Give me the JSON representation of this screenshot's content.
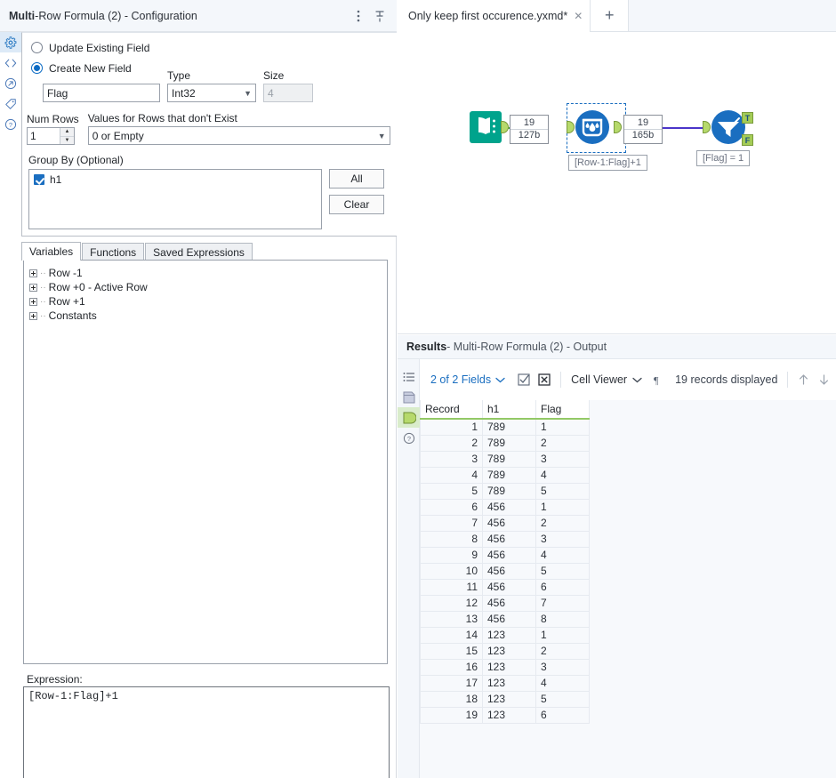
{
  "config_panel": {
    "title_bold": "Multi",
    "title_rest": "-Row Formula (2) - Configuration",
    "menu_icon": "kebab-menu-icon",
    "pin_icon": "pin-icon",
    "rail": [
      {
        "name": "gear-icon",
        "glyph": "⚙"
      },
      {
        "name": "code-icon",
        "glyph": "<>"
      },
      {
        "name": "runtime-icon",
        "glyph": "↗"
      },
      {
        "name": "tag-icon",
        "glyph": "⬟"
      },
      {
        "name": "help-icon",
        "glyph": "?"
      }
    ],
    "update_existing_label": "Update Existing Field",
    "create_new_label": "Create New  Field",
    "field_name_value": "Flag",
    "type_label": "Type",
    "type_value": "Int32",
    "size_label": "Size",
    "size_value": "4",
    "num_rows_label": "Num Rows",
    "num_rows_value": "1",
    "values_missing_label": "Values for Rows that don't Exist",
    "values_missing_value": "0 or Empty",
    "group_by_label": "Group By (Optional)",
    "group_by_items": [
      {
        "label": "h1",
        "checked": true
      }
    ],
    "all_button": "All",
    "clear_button": "Clear",
    "tabs": [
      {
        "label": "Variables",
        "active": true
      },
      {
        "label": "Functions",
        "active": false
      },
      {
        "label": "Saved Expressions",
        "active": false
      }
    ],
    "tree_nodes": [
      {
        "label": "Row -1"
      },
      {
        "label": "Row +0 - Active Row"
      },
      {
        "label": "Row +1"
      },
      {
        "label": "Constants"
      }
    ],
    "expression_label": "Expression:",
    "expression_value": "[Row-1:Flag]+1"
  },
  "workflow": {
    "tab_label": "Only keep first occurence.yxmd*",
    "close_icon": "close-icon",
    "new_tab_icon": "plus-icon",
    "nodes": [
      {
        "name": "input-data-tool",
        "icon": "book-icon",
        "color": "#00a38c",
        "annotation": ""
      },
      {
        "name": "multi-row-formula-tool",
        "icon": "water-drop-icon",
        "color": "#1a6ec0",
        "annotation": "[Row-1:Flag]+1"
      },
      {
        "name": "filter-tool",
        "icon": "funnel-icon",
        "color": "#1a6ec0",
        "annotation": "[Flag] = 1"
      }
    ],
    "record_badges": [
      {
        "records": "19",
        "size": "127b"
      },
      {
        "records": "19",
        "size": "165b"
      }
    ],
    "output_tags": [
      "T",
      "F"
    ],
    "connection_colors": {
      "first": "#4aa74a",
      "second": "#4b35c9"
    }
  },
  "results": {
    "header_bold": "Results",
    "header_rest": " - Multi-Row Formula (2) - Output",
    "rail_icons": [
      {
        "name": "list-icon",
        "glyph": "☰"
      },
      {
        "name": "metadata-icon",
        "glyph": "◧"
      },
      {
        "name": "output-anchor-icon",
        "glyph": "◗",
        "selected": true
      },
      {
        "name": "help-icon",
        "glyph": "?"
      }
    ],
    "toolbar": {
      "fields_label": "2 of 2 Fields",
      "fields_caret": "chevron-down-icon",
      "select_all_icon": "checkbox-checked-icon",
      "deselect_icon": "checkbox-x-icon",
      "view_mode_label": "Cell Viewer",
      "view_mode_caret": "chevron-down-icon",
      "pilcrow_icon": "pilcrow-icon",
      "record_count_label": "19 records displayed",
      "up_icon": "arrow-up-icon",
      "down_icon": "arrow-down-icon"
    },
    "columns": [
      "Record",
      "h1",
      "Flag"
    ],
    "rows": [
      [
        "1",
        "789",
        "1"
      ],
      [
        "2",
        "789",
        "2"
      ],
      [
        "3",
        "789",
        "3"
      ],
      [
        "4",
        "789",
        "4"
      ],
      [
        "5",
        "789",
        "5"
      ],
      [
        "6",
        "456",
        "1"
      ],
      [
        "7",
        "456",
        "2"
      ],
      [
        "8",
        "456",
        "3"
      ],
      [
        "9",
        "456",
        "4"
      ],
      [
        "10",
        "456",
        "5"
      ],
      [
        "11",
        "456",
        "6"
      ],
      [
        "12",
        "456",
        "7"
      ],
      [
        "13",
        "456",
        "8"
      ],
      [
        "14",
        "123",
        "1"
      ],
      [
        "15",
        "123",
        "2"
      ],
      [
        "16",
        "123",
        "3"
      ],
      [
        "17",
        "123",
        "4"
      ],
      [
        "18",
        "123",
        "5"
      ],
      [
        "19",
        "123",
        "6"
      ]
    ]
  }
}
